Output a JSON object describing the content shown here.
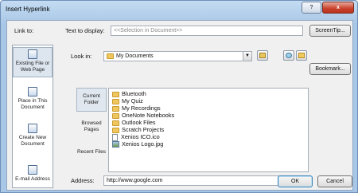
{
  "dialog": {
    "title": "Insert Hyperlink",
    "help": "?",
    "close": "x"
  },
  "link_to": {
    "label": "Link to:",
    "items": [
      {
        "label": "Existing File or Web Page",
        "icon": "existing-file-icon",
        "selected": true
      },
      {
        "label": "Place in This Document",
        "icon": "place-in-document-icon",
        "selected": false
      },
      {
        "label": "Create New Document",
        "icon": "create-document-icon",
        "selected": false
      },
      {
        "label": "E-mail Address",
        "icon": "email-icon",
        "selected": false
      }
    ]
  },
  "text_to_display": {
    "label": "Text to display:",
    "value": "<<Selection in Document>>"
  },
  "screentip": "ScreenTip...",
  "look_in": {
    "label": "Look in:",
    "value": "My Documents"
  },
  "bookmark": "Bookmark...",
  "nav": [
    {
      "label": "Current Folder",
      "selected": true
    },
    {
      "label": "Browsed Pages",
      "selected": false
    },
    {
      "label": "Recent Files",
      "selected": false
    }
  ],
  "files": [
    {
      "name": "Bluetooth",
      "icon": "folder-icon"
    },
    {
      "name": "My Quiz",
      "icon": "folder-icon"
    },
    {
      "name": "My Recordings",
      "icon": "folder-icon"
    },
    {
      "name": "OneNote Notebooks",
      "icon": "folder-icon"
    },
    {
      "name": "Outlook Files",
      "icon": "folder-icon"
    },
    {
      "name": "Scratch Projects",
      "icon": "folder-icon"
    },
    {
      "name": "Xenios ICO.ico",
      "icon": "file-icon"
    },
    {
      "name": "Xenios Logo.jpg",
      "icon": "image-icon"
    }
  ],
  "address": {
    "label": "Address:",
    "value": "http://www.google.com"
  },
  "ok": "OK",
  "cancel": "Cancel"
}
